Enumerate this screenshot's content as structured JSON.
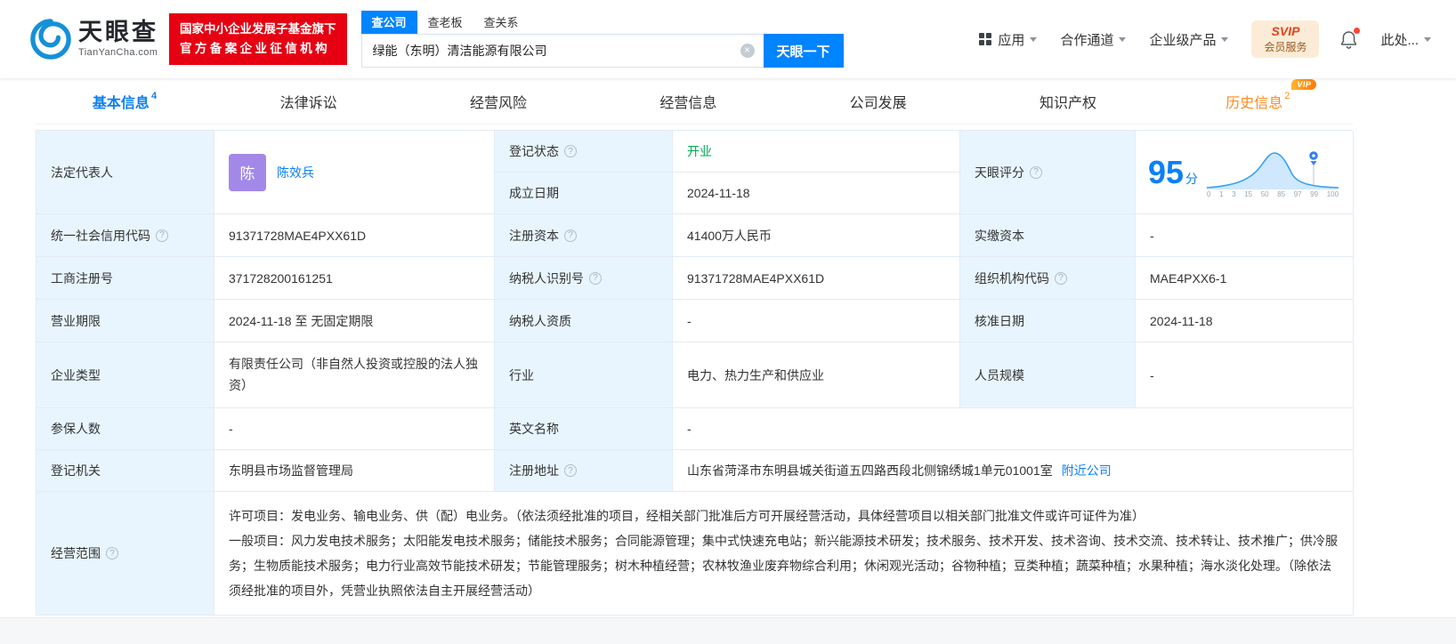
{
  "header": {
    "logo": {
      "cn": "天眼查",
      "en": "TianYanCha.com"
    },
    "badge": {
      "line1": "国家中小企业发展子基金旗下",
      "line2": "官方备案企业征信机构"
    },
    "search_tabs": [
      {
        "label": "查公司"
      },
      {
        "label": "查老板"
      },
      {
        "label": "查关系"
      }
    ],
    "search": {
      "value": "绿能（东明）清洁能源有限公司",
      "button": "天眼一下",
      "clear": "×"
    },
    "nav": [
      {
        "label": "应用"
      },
      {
        "label": "合作通道"
      },
      {
        "label": "企业级产品"
      }
    ],
    "svip": {
      "title": "SVIP",
      "subtitle": "会员服务"
    },
    "more": "此处..."
  },
  "tabs": [
    {
      "label": "基本信息",
      "count": "4"
    },
    {
      "label": "法律诉讼"
    },
    {
      "label": "经营风险"
    },
    {
      "label": "经营信息"
    },
    {
      "label": "公司发展"
    },
    {
      "label": "知识产权"
    },
    {
      "label": "历史信息",
      "count": "2",
      "vip_tag": "VIP"
    }
  ],
  "colors": {
    "accent": "#0084ff",
    "status_green": "#00a854",
    "history_orange": "#ff8a1e",
    "label_bg": "#e8f5fe",
    "badge_red": "#e60012"
  },
  "info": {
    "legal_rep": {
      "label": "法定代表人",
      "avatar": "陈",
      "name": "陈效兵"
    },
    "reg_status": {
      "label": "登记状态",
      "value": "开业"
    },
    "score": {
      "label": "天眼评分",
      "value": "95",
      "unit": "分",
      "axis": [
        "0",
        "1",
        "3",
        "15",
        "50",
        "85",
        "97",
        "99",
        "100"
      ]
    },
    "est_date": {
      "label": "成立日期",
      "value": "2024-11-18"
    },
    "credit_code": {
      "label": "统一社会信用代码",
      "value": "91371728MAE4PXX61D"
    },
    "reg_capital": {
      "label": "注册资本",
      "value": "41400万人民币"
    },
    "paid_capital": {
      "label": "实缴资本",
      "value": "-"
    },
    "reg_number": {
      "label": "工商注册号",
      "value": "371728200161251"
    },
    "taxpayer_id": {
      "label": "纳税人识别号",
      "value": "91371728MAE4PXX61D"
    },
    "org_code": {
      "label": "组织机构代码",
      "value": "MAE4PXX6-1"
    },
    "biz_term": {
      "label": "营业期限",
      "value": "2024-11-18 至 无固定期限"
    },
    "taxpayer_quality": {
      "label": "纳税人资质",
      "value": "-"
    },
    "approval_date": {
      "label": "核准日期",
      "value": "2024-11-18"
    },
    "company_type": {
      "label": "企业类型",
      "value": "有限责任公司（非自然人投资或控股的法人独资）"
    },
    "industry": {
      "label": "行业",
      "value": "电力、热力生产和供应业"
    },
    "staff_size": {
      "label": "人员规模",
      "value": "-"
    },
    "insured": {
      "label": "参保人数",
      "value": "-"
    },
    "english_name": {
      "label": "英文名称",
      "value": "-"
    },
    "reg_authority": {
      "label": "登记机关",
      "value": "东明县市场监督管理局"
    },
    "reg_address": {
      "label": "注册地址",
      "value": "山东省菏泽市东明县城关街道五四路西段北侧锦绣城1单元01001室",
      "link": "附近公司"
    },
    "biz_scope": {
      "label": "经营范围",
      "line1": "许可项目：发电业务、输电业务、供（配）电业务。（依法须经批准的项目，经相关部门批准后方可开展经营活动，具体经营项目以相关部门批准文件或许可证件为准）",
      "line2": "一般项目：风力发电技术服务；太阳能发电技术服务；储能技术服务；合同能源管理；集中式快速充电站；新兴能源技术研发；技术服务、技术开发、技术咨询、技术交流、技术转让、技术推广；供冷服务；生物质能技术服务；电力行业高效节能技术研发；节能管理服务；树木种植经营；农林牧渔业废弃物综合利用；休闲观光活动；谷物种植；豆类种植；蔬菜种植；水果种植；海水淡化处理。（除依法须经批准的项目外，凭营业执照依法自主开展经营活动）"
    }
  }
}
